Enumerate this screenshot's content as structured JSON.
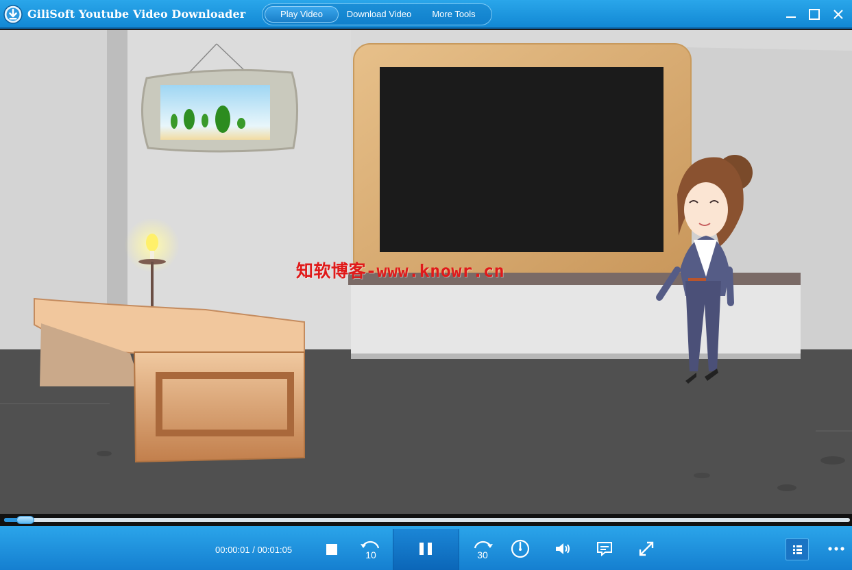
{
  "app": {
    "title": "GiliSoft Youtube Video Downloader"
  },
  "tabs": [
    {
      "label": "Play Video",
      "active": true
    },
    {
      "label": "Download Video",
      "active": false
    },
    {
      "label": "More Tools",
      "active": false
    }
  ],
  "window_controls": [
    "minimize-icon",
    "maximize-icon",
    "close-icon"
  ],
  "video": {
    "watermark": "知软博客-www.knowr.cn"
  },
  "playback": {
    "current_time": "00:00:01",
    "separator": " / ",
    "duration": "00:01:05",
    "progress_fraction": 0.025
  },
  "controls": {
    "icons": [
      "stop-icon",
      "rewind-10-icon",
      "pause-icon",
      "forward-30-icon",
      "speed-icon",
      "volume-icon",
      "subtitle-icon",
      "fullscreen-icon",
      "playlist-icon",
      "more-icon"
    ],
    "rewind_seconds": "10",
    "forward_seconds": "30"
  },
  "colors": {
    "accent": "#1a8fdb",
    "titlebar": "#1e98e0",
    "watermark": "#e01a1a"
  }
}
